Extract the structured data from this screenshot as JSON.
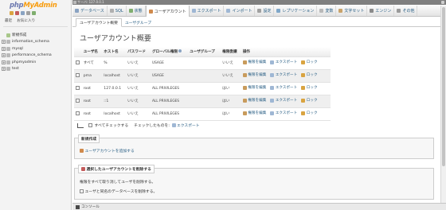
{
  "sidebar": {
    "logo": {
      "php": "php",
      "my": "My",
      "admin": "Admin"
    },
    "tabs": [
      "最近",
      "お気に入り"
    ],
    "tree": [
      {
        "label": "新規作成",
        "type": "new"
      },
      {
        "label": "information_schema",
        "type": "db"
      },
      {
        "label": "mysql",
        "type": "db"
      },
      {
        "label": "performance_schema",
        "type": "db"
      },
      {
        "label": "phpmyadmin",
        "type": "db"
      },
      {
        "label": "test",
        "type": "db"
      }
    ]
  },
  "topbar": {
    "breadcrumb": "サーバ: 127.0.0.1"
  },
  "menu": {
    "tabs": [
      {
        "label": "データベース",
        "color": "#8aa3c2"
      },
      {
        "label": "SQL",
        "color": "#b0b0b0"
      },
      {
        "label": "状態",
        "color": "#7fae6e"
      },
      {
        "label": "ユーザアカウント",
        "color": "#d08a4c",
        "active": true
      },
      {
        "label": "エクスポート",
        "color": "#9fb7d4"
      },
      {
        "label": "インポート",
        "color": "#9fb7d4"
      },
      {
        "label": "設定",
        "color": "#a0a0a0"
      },
      {
        "label": "レプリケーション",
        "color": "#7fa7c9"
      },
      {
        "label": "変数",
        "color": "#b9b9b9"
      },
      {
        "label": "文字セット",
        "color": "#c9a36a"
      },
      {
        "label": "エンジン",
        "color": "#8a8a8a"
      },
      {
        "label": "その他",
        "color": "#9a9a9a"
      }
    ]
  },
  "subtabs": [
    {
      "label": "ユーザアカウント概要",
      "active": true
    },
    {
      "label": "ユーザグループ",
      "active": false
    }
  ],
  "page_title": "ユーザアカウント概要",
  "table": {
    "headers": [
      "",
      "ユーザ名",
      "ホスト名",
      "パスワード",
      "グローバル権限",
      "ユーザグループ",
      "権限委譲",
      "操作"
    ],
    "rows": [
      {
        "user": "すべて",
        "user_red": true,
        "host": "%",
        "password": "いいえ",
        "privileges": "USAGE",
        "group": "",
        "grant": "いいえ"
      },
      {
        "user": "pma",
        "user_red": false,
        "host": "localhost",
        "password": "いいえ",
        "privileges": "USAGE",
        "group": "",
        "grant": "いいえ"
      },
      {
        "user": "root",
        "user_red": false,
        "host": "127.0.0.1",
        "password": "いいえ",
        "privileges": "ALL PRIVILEGES",
        "group": "",
        "grant": "はい"
      },
      {
        "user": "root",
        "user_red": false,
        "host": "::1",
        "password": "いいえ",
        "privileges": "ALL PRIVILEGES",
        "group": "",
        "grant": "はい"
      },
      {
        "user": "root",
        "user_red": false,
        "host": "localhost",
        "password": "いいえ",
        "privileges": "ALL PRIVILEGES",
        "group": "",
        "grant": "はい"
      }
    ],
    "actions": {
      "edit": "権限を編集",
      "export": "エクスポート",
      "lock": "ロック"
    }
  },
  "with_selected": {
    "check_all": "すべてチェックする",
    "label": "チェックしたものを:",
    "export": "エクスポート"
  },
  "new_section": {
    "legend": "新規作成",
    "link": "ユーザアカウントを追加する"
  },
  "remove_section": {
    "legend": "選択したユーザアカウントを削除する",
    "line1": "権限をすべて取り消してユーザを削除する。",
    "line2": "ユーザと同名のデータベースを削除する。"
  },
  "console": {
    "label": "コンソール"
  }
}
